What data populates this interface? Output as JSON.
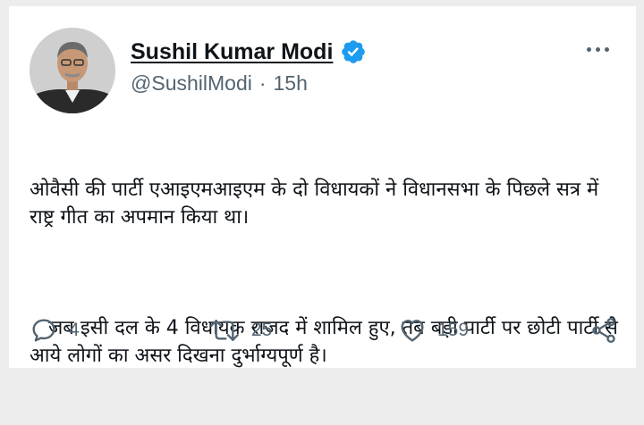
{
  "author": {
    "name": "Sushil Kumar Modi",
    "handle": "@SushilModi",
    "separator": "·",
    "time": "15h"
  },
  "tweet": {
    "paragraph1": "ओवैसी की पार्टी एआइएमआइएम के दो विधायकों ने विधानसभा के पिछले सत्र में राष्ट्र गीत का अपमान किया था।",
    "paragraph2": "   जब इसी दल के 4 विधायक राजद में शामिल हुए, तब बड़ी पार्टी पर छोटी पार्टी से आये लोगों का असर दिखना दुर्भाग्यपूर्ण है।"
  },
  "actions": {
    "replies": "4",
    "retweets": "25",
    "likes": "159"
  },
  "icons": {
    "verified": "verified-badge-icon",
    "more": "more-dots-icon",
    "reply": "reply-bubble-icon",
    "retweet": "retweet-icon",
    "like": "heart-icon",
    "share": "share-icon"
  },
  "colors": {
    "verified": "#1d9bf0",
    "muted": "#536471",
    "text": "#0f1419",
    "background": "#ededed"
  }
}
